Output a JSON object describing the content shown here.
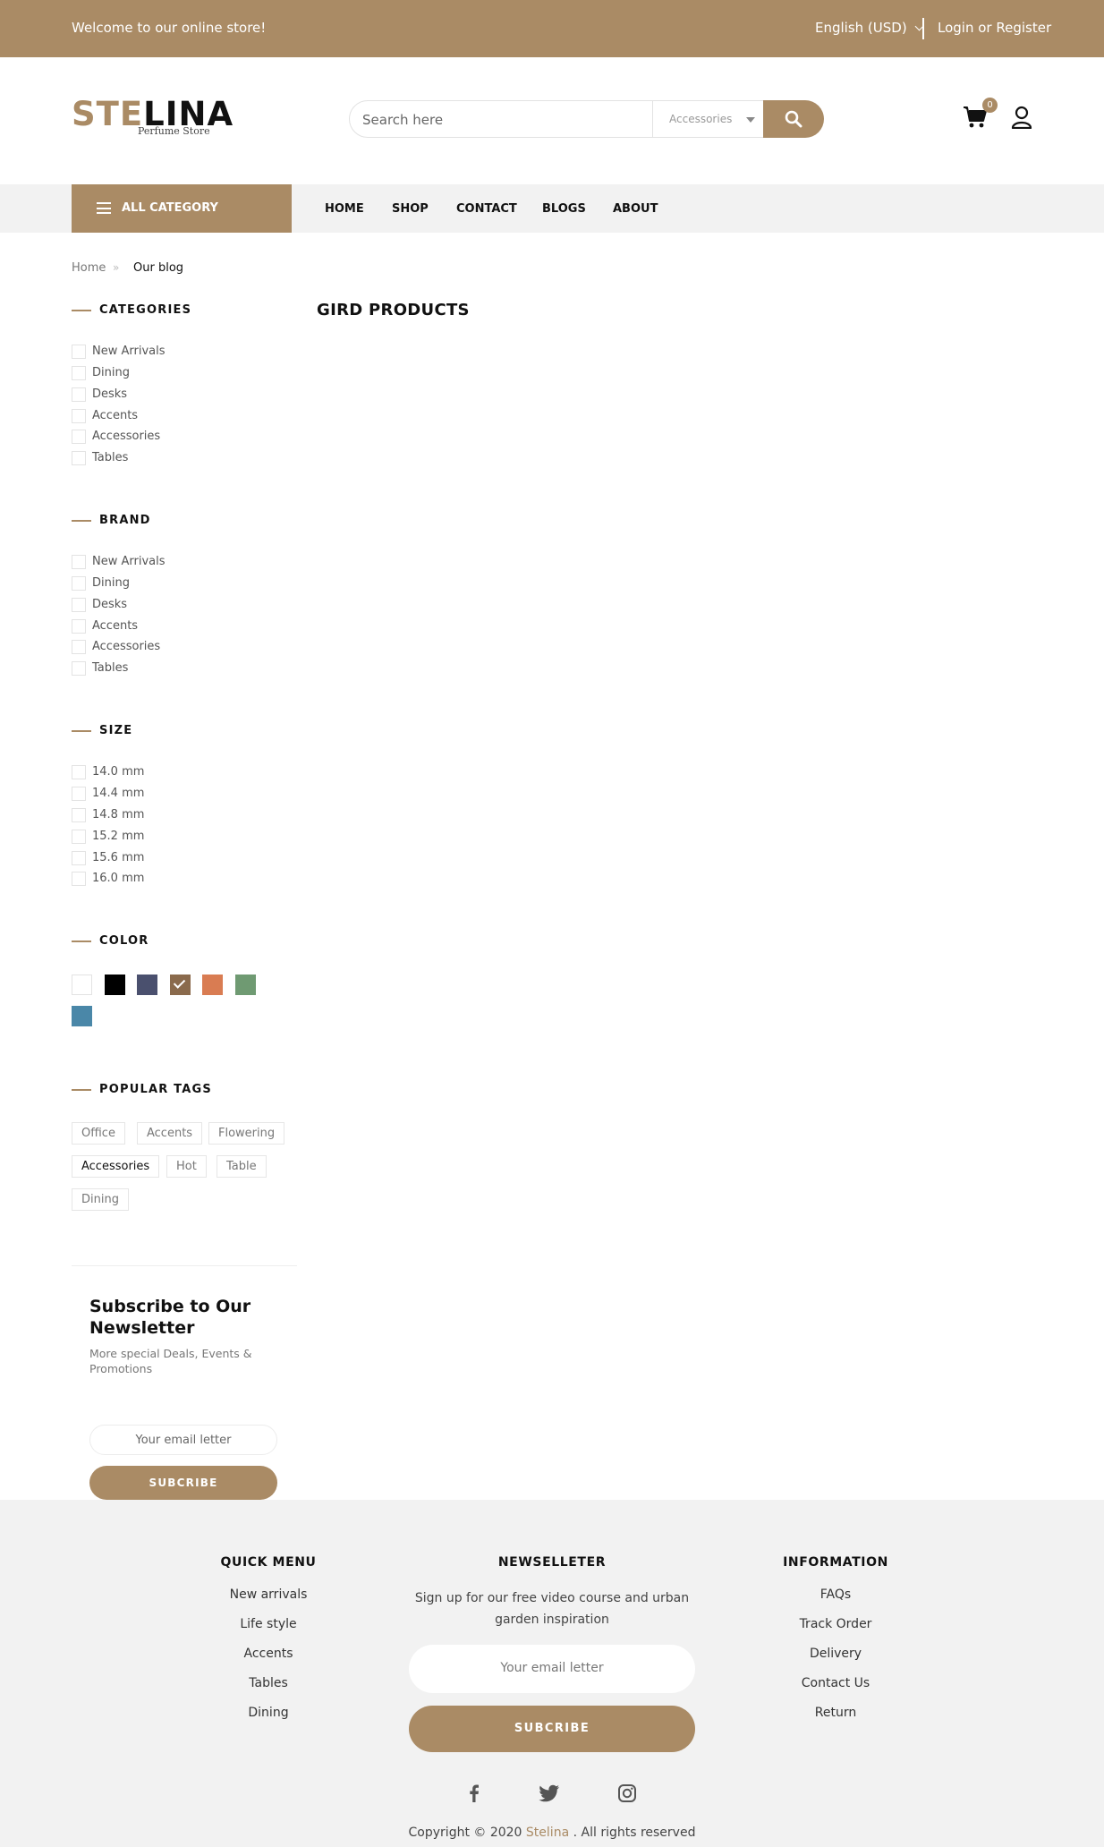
{
  "colors": {
    "accent": "#aa8b65",
    "topbar_text": "#ffffff",
    "nav_bg": "#f2f2f2",
    "footer_bg": "#f2f2f2"
  },
  "topbar": {
    "welcome": "Welcome to our online store!",
    "language": "English (USD)",
    "login": "Login or Register"
  },
  "header": {
    "logo_part1": "STE",
    "logo_part2": "LINA",
    "logo_tagline": "Perfume Store",
    "search_placeholder": "Search here",
    "search_category": "Accessories",
    "cart_count": "0",
    "icons": [
      "search-icon",
      "cart-icon",
      "user-icon"
    ]
  },
  "nav": {
    "all_category": "ALL CATEGORY",
    "links": [
      "HOME",
      "SHOP",
      "CONTACT",
      "BLOGS",
      "ABOUT"
    ]
  },
  "breadcrumb": {
    "home": "Home",
    "separator": "»",
    "current": "Our blog"
  },
  "main": {
    "title": "GIRD PRODUCTS"
  },
  "sidebar": {
    "categories": {
      "title": "CATEGORIES",
      "items": [
        "New Arrivals",
        "Dining",
        "Desks",
        "Accents",
        "Accessories",
        "Tables"
      ]
    },
    "brand": {
      "title": "BRAND",
      "items": [
        "New Arrivals",
        "Dining",
        "Desks",
        "Accents",
        "Accessories",
        "Tables"
      ]
    },
    "size": {
      "title": "SIZE",
      "items": [
        "14.0 mm",
        "14.4 mm",
        "14.8 mm",
        "15.2 mm",
        "15.6 mm",
        "16.0 mm"
      ]
    },
    "color": {
      "title": "COLOR",
      "swatches": [
        "#ffffff",
        "#000000",
        "#4a506e",
        "#8a6a4c",
        "#d97c52",
        "#6f9a72",
        "#4a87a8"
      ],
      "selected_index": 3
    },
    "tags": {
      "title": "POPULAR TAGS",
      "items": [
        "Office",
        "Accents",
        "Flowering",
        "Accessories",
        "Hot",
        "Table",
        "Dining"
      ],
      "active_index": 3
    },
    "newsletter": {
      "title": "Subscribe to Our Newsletter",
      "subtitle": "More special Deals, Events & Promotions",
      "placeholder": "Your email letter",
      "button": "SUBCRIBE"
    }
  },
  "footer": {
    "quick_menu": {
      "title": "QUICK MENU",
      "items": [
        "New arrivals",
        "Life style",
        "Accents",
        "Tables",
        "Dining"
      ]
    },
    "newsletter": {
      "title": "NEWSELLETER",
      "text": "Sign up for our free video course and urban garden inspiration",
      "placeholder": "Your email letter",
      "button": "SUBCRIBE"
    },
    "information": {
      "title": "INFORMATION",
      "items": [
        "FAQs",
        "Track Order",
        "Delivery",
        "Contact Us",
        "Return"
      ]
    },
    "social": [
      "facebook-icon",
      "twitter-icon",
      "instagram-icon"
    ],
    "copyright_prefix": "Copyright © 2020",
    "copyright_brand": "Stelina",
    "copyright_suffix": ". All rights reserved"
  }
}
